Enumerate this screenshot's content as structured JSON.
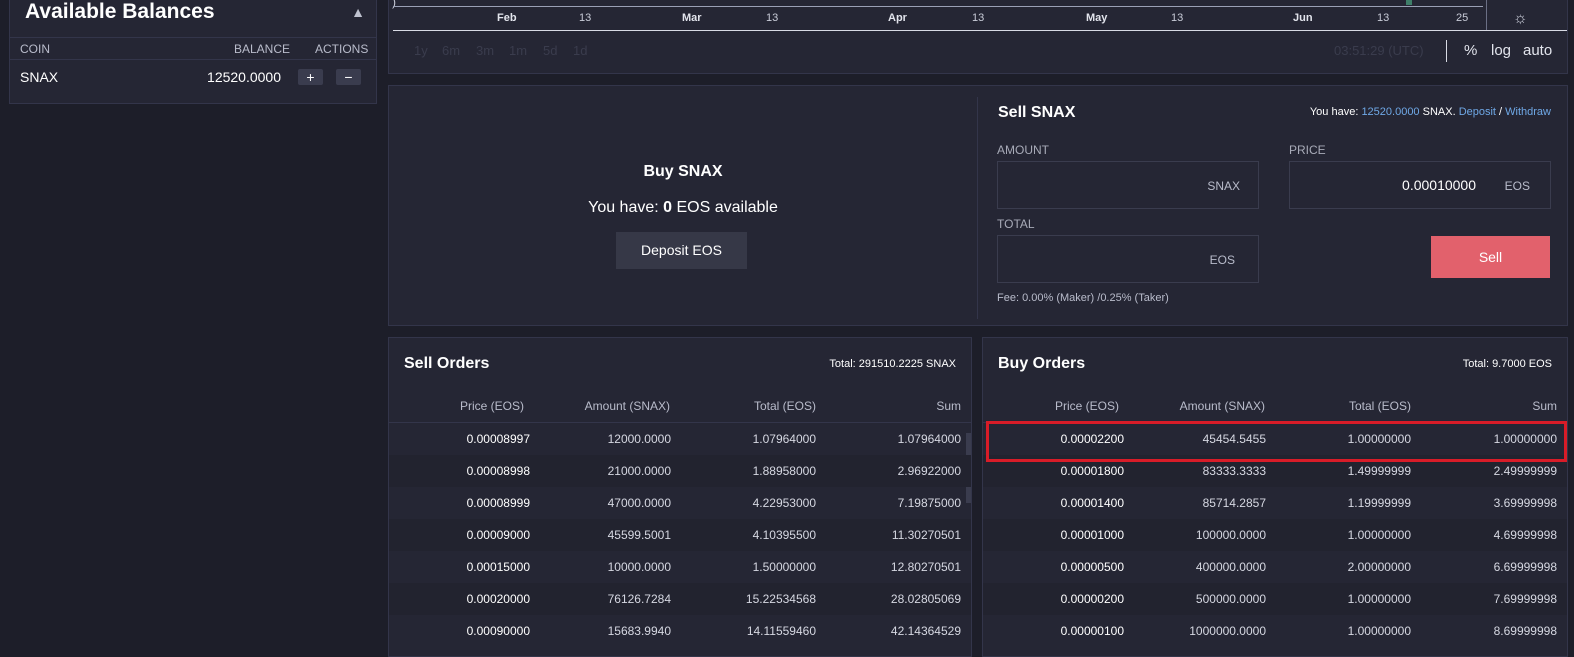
{
  "balances": {
    "title": "Available Balances",
    "collapse_icon": "▲",
    "columns": {
      "coin": "COIN",
      "balance": "BALANCE",
      "actions": "ACTIONS"
    },
    "rows": [
      {
        "coin": "SNAX",
        "balance": "12520.0000",
        "deposit": "+",
        "withdraw": "−"
      }
    ]
  },
  "chart": {
    "ticks": [
      {
        "label": "Feb",
        "month": true
      },
      {
        "label": "13",
        "month": false
      },
      {
        "label": "Mar",
        "month": true
      },
      {
        "label": "13",
        "month": false
      },
      {
        "label": "Apr",
        "month": true
      },
      {
        "label": "13",
        "month": false
      },
      {
        "label": "May",
        "month": true
      },
      {
        "label": "13",
        "month": false
      },
      {
        "label": "Jun",
        "month": true
      },
      {
        "label": "13",
        "month": false
      },
      {
        "label": "25",
        "month": false
      }
    ],
    "ranges": [
      "1y",
      "6m",
      "3m",
      "1m",
      "5d",
      "1d"
    ],
    "clock": "03:51:29 (UTC)",
    "options": [
      "%",
      "log",
      "auto"
    ],
    "settings_icon": "☼",
    "left_marker": ")"
  },
  "buy_panel": {
    "title": "Buy SNAX",
    "have_prefix": "You have: ",
    "have_amount": "0",
    "have_suffix": " EOS available",
    "deposit_button": "Deposit EOS"
  },
  "sell_panel": {
    "title": "Sell SNAX",
    "you_have_prefix": "You have: ",
    "you_have_amount": "12520.0000",
    "you_have_coin": " SNAX. ",
    "deposit_link": "Deposit",
    "slash": " / ",
    "withdraw_link": "Withdraw",
    "amount_label": "AMOUNT",
    "amount_unit": "SNAX",
    "price_label": "PRICE",
    "price_value": "0.00010000",
    "price_unit": "EOS",
    "total_label": "TOTAL",
    "total_unit": "EOS",
    "fee_text": "Fee: 0.00% (Maker) /0.25% (Taker)",
    "sell_button": "Sell"
  },
  "sell_orders": {
    "title": "Sell Orders",
    "total": "Total: 291510.2225 SNAX",
    "columns": [
      "Price (EOS)",
      "Amount (SNAX)",
      "Total (EOS)",
      "Sum"
    ],
    "rows": [
      [
        "0.00008997",
        "12000.0000",
        "1.07964000",
        "1.07964000"
      ],
      [
        "0.00008998",
        "21000.0000",
        "1.88958000",
        "2.96922000"
      ],
      [
        "0.00008999",
        "47000.0000",
        "4.22953000",
        "7.19875000"
      ],
      [
        "0.00009000",
        "45599.5001",
        "4.10395500",
        "11.30270501"
      ],
      [
        "0.00015000",
        "10000.0000",
        "1.50000000",
        "12.80270501"
      ],
      [
        "0.00020000",
        "76126.7284",
        "15.22534568",
        "28.02805069"
      ],
      [
        "0.00090000",
        "15683.9940",
        "14.11559460",
        "42.14364529"
      ]
    ]
  },
  "buy_orders": {
    "title": "Buy Orders",
    "total": "Total: 9.7000 EOS",
    "columns": [
      "Price (EOS)",
      "Amount (SNAX)",
      "Total (EOS)",
      "Sum"
    ],
    "rows": [
      [
        "0.00002200",
        "45454.5455",
        "1.00000000",
        "1.00000000"
      ],
      [
        "0.00001800",
        "83333.3333",
        "1.49999999",
        "2.49999999"
      ],
      [
        "0.00001400",
        "85714.2857",
        "1.19999999",
        "3.69999998"
      ],
      [
        "0.00001000",
        "100000.0000",
        "1.00000000",
        "4.69999998"
      ],
      [
        "0.00000500",
        "400000.0000",
        "2.00000000",
        "6.69999998"
      ],
      [
        "0.00000200",
        "500000.0000",
        "1.00000000",
        "7.69999998"
      ],
      [
        "0.00000100",
        "1000000.0000",
        "1.00000000",
        "8.69999998"
      ]
    ]
  },
  "colors": {
    "sell_accent": "#e2616c",
    "highlight": "#d81c28",
    "link": "#6fa8e6"
  }
}
